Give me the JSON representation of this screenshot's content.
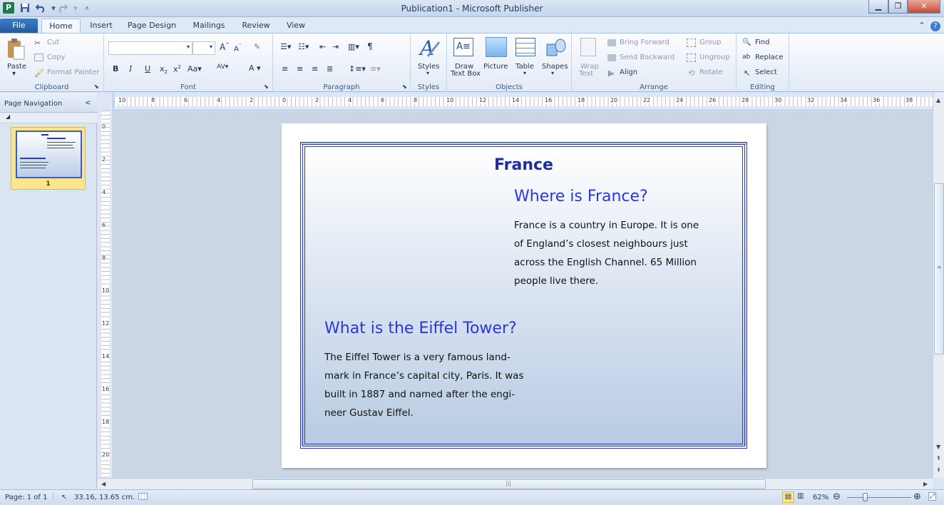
{
  "window": {
    "title": "Publication1 - Microsoft Publisher",
    "app_icon": "P",
    "quick_access": [
      "save-icon",
      "undo-icon",
      "redo-icon",
      "customize-icon"
    ],
    "controls": [
      "minimize",
      "maximize",
      "close"
    ]
  },
  "tabs": [
    {
      "label": "File"
    },
    {
      "label": "Home"
    },
    {
      "label": "Insert"
    },
    {
      "label": "Page Design"
    },
    {
      "label": "Mailings"
    },
    {
      "label": "Review"
    },
    {
      "label": "View"
    }
  ],
  "ribbon": {
    "clipboard": {
      "label": "Clipboard",
      "paste": "Paste",
      "cut": "Cut",
      "copy": "Copy",
      "format_painter": "Format Painter"
    },
    "font": {
      "label": "Font"
    },
    "paragraph": {
      "label": "Paragraph"
    },
    "styles": {
      "label": "Styles",
      "button": "Styles"
    },
    "objects": {
      "label": "Objects",
      "draw_text_box_1": "Draw",
      "draw_text_box_2": "Text Box",
      "picture": "Picture",
      "table": "Table",
      "shapes": "Shapes"
    },
    "arrange": {
      "label": "Arrange",
      "wrap_1": "Wrap",
      "wrap_2": "Text",
      "bring_forward": "Bring Forward",
      "send_backward": "Send Backward",
      "align": "Align",
      "group": "Group",
      "ungroup": "Ungroup",
      "rotate": "Rotate"
    },
    "editing": {
      "label": "Editing",
      "find": "Find",
      "replace": "Replace",
      "select": "Select"
    }
  },
  "nav": {
    "title": "Page Navigation",
    "collapse": "<",
    "pages": [
      {
        "number": "1"
      }
    ]
  },
  "ruler": {
    "h_ticks": [
      "10",
      "8",
      "6",
      "4",
      "2",
      "0",
      "2",
      "4",
      "6",
      "8",
      "10",
      "12",
      "14",
      "16",
      "18",
      "20",
      "22",
      "24",
      "26",
      "28",
      "30",
      "32",
      "34",
      "36",
      "38"
    ],
    "v_ticks": [
      "0",
      "2",
      "4",
      "6",
      "8",
      "10",
      "12",
      "14",
      "16",
      "18",
      "20"
    ]
  },
  "document": {
    "title": "France",
    "section1": {
      "heading": "Where is France?",
      "lines": [
        "France is a country in Europe. It is  one",
        "of England’s closest neighbours just",
        "across the English Channel. 65 Million",
        "people live there."
      ]
    },
    "section2": {
      "heading": "What is the Eiffel Tower?",
      "lines": [
        "The Eiffel Tower is a very famous land-",
        "mark in France’s capital city, Paris. It was",
        "built in 1887 and named after the engi-",
        "neer Gustav Eiffel."
      ]
    }
  },
  "status": {
    "page": "Page: 1 of 1",
    "position": "33.16, 13.65 cm.",
    "zoom": "62%"
  },
  "colors": {
    "frame_border": "#2a35d6",
    "heading": "#2a38d8",
    "title": "#1f2d9e",
    "file_tab": "#2b63aa"
  }
}
